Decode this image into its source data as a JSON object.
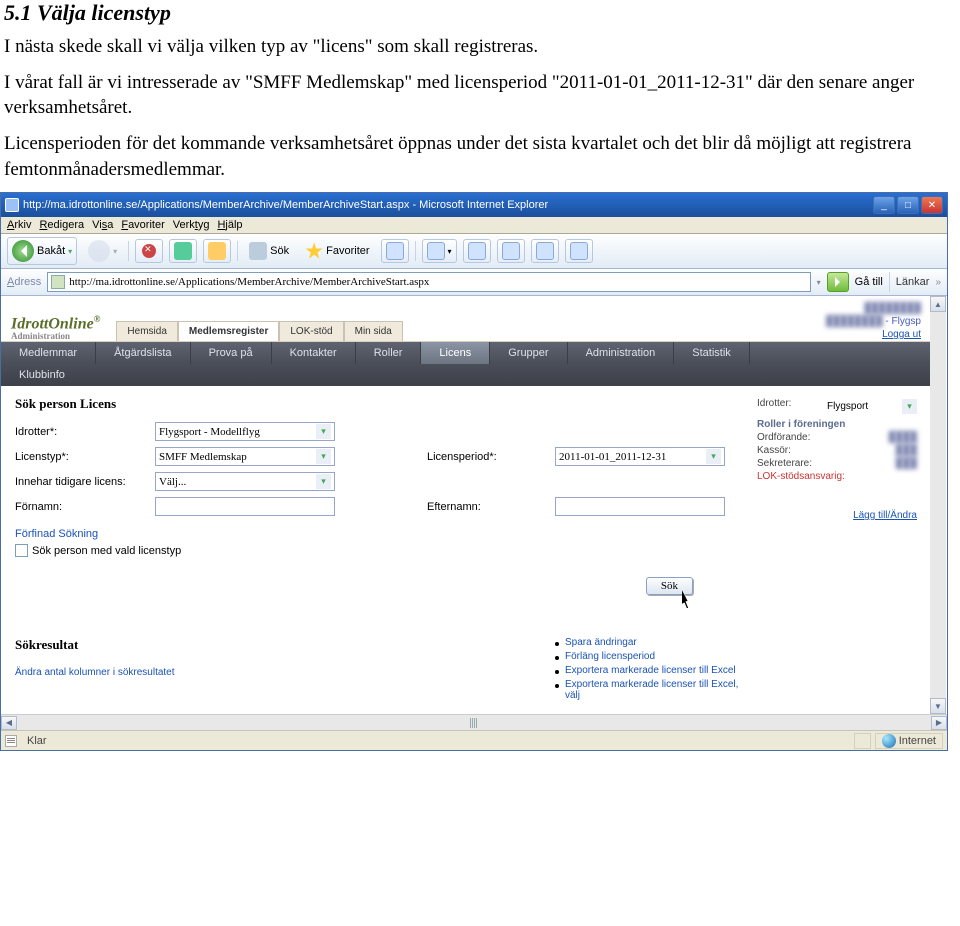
{
  "doc": {
    "heading": "5.1  Välja licenstyp",
    "p1": "I nästa skede skall vi välja vilken typ av \"licens\" som skall registreras.",
    "p2": "I vårat fall är vi intresserade av \"SMFF Medlemskap\" med licensperiod \"2011-01-01_2011-12-31\" där den senare anger verksamhetsåret.",
    "p3": "Licensperioden för det kommande verksamhetsåret öppnas under det sista kvartalet och det blir då möjligt att registrera femtonmånadersmedlemmar."
  },
  "ie": {
    "title": "http://ma.idrottonline.se/Applications/MemberArchive/MemberArchiveStart.aspx - Microsoft Internet Explorer",
    "menu": [
      "Arkiv",
      "Redigera",
      "Visa",
      "Favoriter",
      "Verktyg",
      "Hjälp"
    ],
    "btn_back": "Bakåt",
    "btn_search": "Sök",
    "btn_fav": "Favoriter",
    "addr_label": "Adress",
    "url": "http://ma.idrottonline.se/Applications/MemberArchive/MemberArchiveStart.aspx",
    "go": "Gå till",
    "links": "Länkar"
  },
  "brand": {
    "logo1": "IdrottOnline",
    "logo2": "Administration",
    "tabs": [
      "Hemsida",
      "Medlemsregister",
      "LOK-stöd",
      "Min sida"
    ],
    "org": " - Flygsp",
    "logout": "Logga ut"
  },
  "nav": {
    "row1": [
      "Medlemmar",
      "Åtgärdslista",
      "Prova på",
      "Kontakter",
      "Roller",
      "Licens",
      "Grupper",
      "Administration",
      "Statistik"
    ],
    "row2": [
      "Klubbinfo"
    ],
    "active": "Licens"
  },
  "search": {
    "title": "Sök person Licens",
    "labels": {
      "idrotter": "Idrotter*:",
      "licenstyp": "Licenstyp*:",
      "innehar": "Innehar tidigare licens:",
      "fornamn": "Förnamn:",
      "licensperiod": "Licensperiod*:",
      "efternamn": "Efternamn:"
    },
    "values": {
      "idrotter": "Flygsport - Modellflyg",
      "licenstyp": "SMFF Medlemskap",
      "innehar": "Välj...",
      "fornamn": "",
      "licensperiod": "2011-01-01_2011-12-31",
      "efternamn": ""
    },
    "refine_link": "Förfinad Sökning",
    "checkbox_label": "Sök person med vald licenstyp",
    "sok_btn": "Sök"
  },
  "side": {
    "idrotter_label": "Idrotter:",
    "idrotter_value": "Flygsport",
    "roles_heading": "Roller i föreningen",
    "roles": [
      {
        "label": "Ordförande:",
        "cls": "lbl"
      },
      {
        "label": "Kassör:",
        "cls": "lbl"
      },
      {
        "label": "Sekreterare:",
        "cls": "lbl"
      },
      {
        "label": "LOK-stödsansvarig:",
        "cls": "redlbl"
      }
    ],
    "add_link": "Lägg till/Ändra"
  },
  "results": {
    "title": "Sökresultat",
    "change_cols": "Ändra antal kolumner i sökresultatet",
    "actions": [
      "Spara ändringar",
      "Förläng licensperiod",
      "Exportera markerade licenser till Excel",
      "Exportera markerade licenser till Excel, välj"
    ]
  },
  "status": {
    "klar": "Klar",
    "zone": "Internet"
  }
}
